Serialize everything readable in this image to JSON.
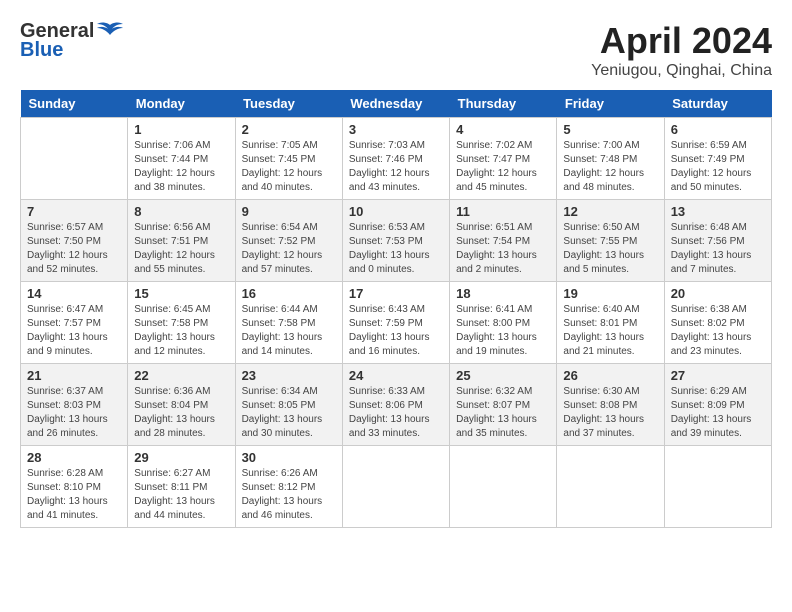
{
  "header": {
    "logo_general": "General",
    "logo_blue": "Blue",
    "month_title": "April 2024",
    "location": "Yeniugou, Qinghai, China"
  },
  "weekdays": [
    "Sunday",
    "Monday",
    "Tuesday",
    "Wednesday",
    "Thursday",
    "Friday",
    "Saturday"
  ],
  "weeks": [
    [
      {
        "date": "",
        "sunrise": "",
        "sunset": "",
        "daylight": ""
      },
      {
        "date": "1",
        "sunrise": "Sunrise: 7:06 AM",
        "sunset": "Sunset: 7:44 PM",
        "daylight": "Daylight: 12 hours and 38 minutes."
      },
      {
        "date": "2",
        "sunrise": "Sunrise: 7:05 AM",
        "sunset": "Sunset: 7:45 PM",
        "daylight": "Daylight: 12 hours and 40 minutes."
      },
      {
        "date": "3",
        "sunrise": "Sunrise: 7:03 AM",
        "sunset": "Sunset: 7:46 PM",
        "daylight": "Daylight: 12 hours and 43 minutes."
      },
      {
        "date": "4",
        "sunrise": "Sunrise: 7:02 AM",
        "sunset": "Sunset: 7:47 PM",
        "daylight": "Daylight: 12 hours and 45 minutes."
      },
      {
        "date": "5",
        "sunrise": "Sunrise: 7:00 AM",
        "sunset": "Sunset: 7:48 PM",
        "daylight": "Daylight: 12 hours and 48 minutes."
      },
      {
        "date": "6",
        "sunrise": "Sunrise: 6:59 AM",
        "sunset": "Sunset: 7:49 PM",
        "daylight": "Daylight: 12 hours and 50 minutes."
      }
    ],
    [
      {
        "date": "7",
        "sunrise": "Sunrise: 6:57 AM",
        "sunset": "Sunset: 7:50 PM",
        "daylight": "Daylight: 12 hours and 52 minutes."
      },
      {
        "date": "8",
        "sunrise": "Sunrise: 6:56 AM",
        "sunset": "Sunset: 7:51 PM",
        "daylight": "Daylight: 12 hours and 55 minutes."
      },
      {
        "date": "9",
        "sunrise": "Sunrise: 6:54 AM",
        "sunset": "Sunset: 7:52 PM",
        "daylight": "Daylight: 12 hours and 57 minutes."
      },
      {
        "date": "10",
        "sunrise": "Sunrise: 6:53 AM",
        "sunset": "Sunset: 7:53 PM",
        "daylight": "Daylight: 13 hours and 0 minutes."
      },
      {
        "date": "11",
        "sunrise": "Sunrise: 6:51 AM",
        "sunset": "Sunset: 7:54 PM",
        "daylight": "Daylight: 13 hours and 2 minutes."
      },
      {
        "date": "12",
        "sunrise": "Sunrise: 6:50 AM",
        "sunset": "Sunset: 7:55 PM",
        "daylight": "Daylight: 13 hours and 5 minutes."
      },
      {
        "date": "13",
        "sunrise": "Sunrise: 6:48 AM",
        "sunset": "Sunset: 7:56 PM",
        "daylight": "Daylight: 13 hours and 7 minutes."
      }
    ],
    [
      {
        "date": "14",
        "sunrise": "Sunrise: 6:47 AM",
        "sunset": "Sunset: 7:57 PM",
        "daylight": "Daylight: 13 hours and 9 minutes."
      },
      {
        "date": "15",
        "sunrise": "Sunrise: 6:45 AM",
        "sunset": "Sunset: 7:58 PM",
        "daylight": "Daylight: 13 hours and 12 minutes."
      },
      {
        "date": "16",
        "sunrise": "Sunrise: 6:44 AM",
        "sunset": "Sunset: 7:58 PM",
        "daylight": "Daylight: 13 hours and 14 minutes."
      },
      {
        "date": "17",
        "sunrise": "Sunrise: 6:43 AM",
        "sunset": "Sunset: 7:59 PM",
        "daylight": "Daylight: 13 hours and 16 minutes."
      },
      {
        "date": "18",
        "sunrise": "Sunrise: 6:41 AM",
        "sunset": "Sunset: 8:00 PM",
        "daylight": "Daylight: 13 hours and 19 minutes."
      },
      {
        "date": "19",
        "sunrise": "Sunrise: 6:40 AM",
        "sunset": "Sunset: 8:01 PM",
        "daylight": "Daylight: 13 hours and 21 minutes."
      },
      {
        "date": "20",
        "sunrise": "Sunrise: 6:38 AM",
        "sunset": "Sunset: 8:02 PM",
        "daylight": "Daylight: 13 hours and 23 minutes."
      }
    ],
    [
      {
        "date": "21",
        "sunrise": "Sunrise: 6:37 AM",
        "sunset": "Sunset: 8:03 PM",
        "daylight": "Daylight: 13 hours and 26 minutes."
      },
      {
        "date": "22",
        "sunrise": "Sunrise: 6:36 AM",
        "sunset": "Sunset: 8:04 PM",
        "daylight": "Daylight: 13 hours and 28 minutes."
      },
      {
        "date": "23",
        "sunrise": "Sunrise: 6:34 AM",
        "sunset": "Sunset: 8:05 PM",
        "daylight": "Daylight: 13 hours and 30 minutes."
      },
      {
        "date": "24",
        "sunrise": "Sunrise: 6:33 AM",
        "sunset": "Sunset: 8:06 PM",
        "daylight": "Daylight: 13 hours and 33 minutes."
      },
      {
        "date": "25",
        "sunrise": "Sunrise: 6:32 AM",
        "sunset": "Sunset: 8:07 PM",
        "daylight": "Daylight: 13 hours and 35 minutes."
      },
      {
        "date": "26",
        "sunrise": "Sunrise: 6:30 AM",
        "sunset": "Sunset: 8:08 PM",
        "daylight": "Daylight: 13 hours and 37 minutes."
      },
      {
        "date": "27",
        "sunrise": "Sunrise: 6:29 AM",
        "sunset": "Sunset: 8:09 PM",
        "daylight": "Daylight: 13 hours and 39 minutes."
      }
    ],
    [
      {
        "date": "28",
        "sunrise": "Sunrise: 6:28 AM",
        "sunset": "Sunset: 8:10 PM",
        "daylight": "Daylight: 13 hours and 41 minutes."
      },
      {
        "date": "29",
        "sunrise": "Sunrise: 6:27 AM",
        "sunset": "Sunset: 8:11 PM",
        "daylight": "Daylight: 13 hours and 44 minutes."
      },
      {
        "date": "30",
        "sunrise": "Sunrise: 6:26 AM",
        "sunset": "Sunset: 8:12 PM",
        "daylight": "Daylight: 13 hours and 46 minutes."
      },
      {
        "date": "",
        "sunrise": "",
        "sunset": "",
        "daylight": ""
      },
      {
        "date": "",
        "sunrise": "",
        "sunset": "",
        "daylight": ""
      },
      {
        "date": "",
        "sunrise": "",
        "sunset": "",
        "daylight": ""
      },
      {
        "date": "",
        "sunrise": "",
        "sunset": "",
        "daylight": ""
      }
    ]
  ]
}
